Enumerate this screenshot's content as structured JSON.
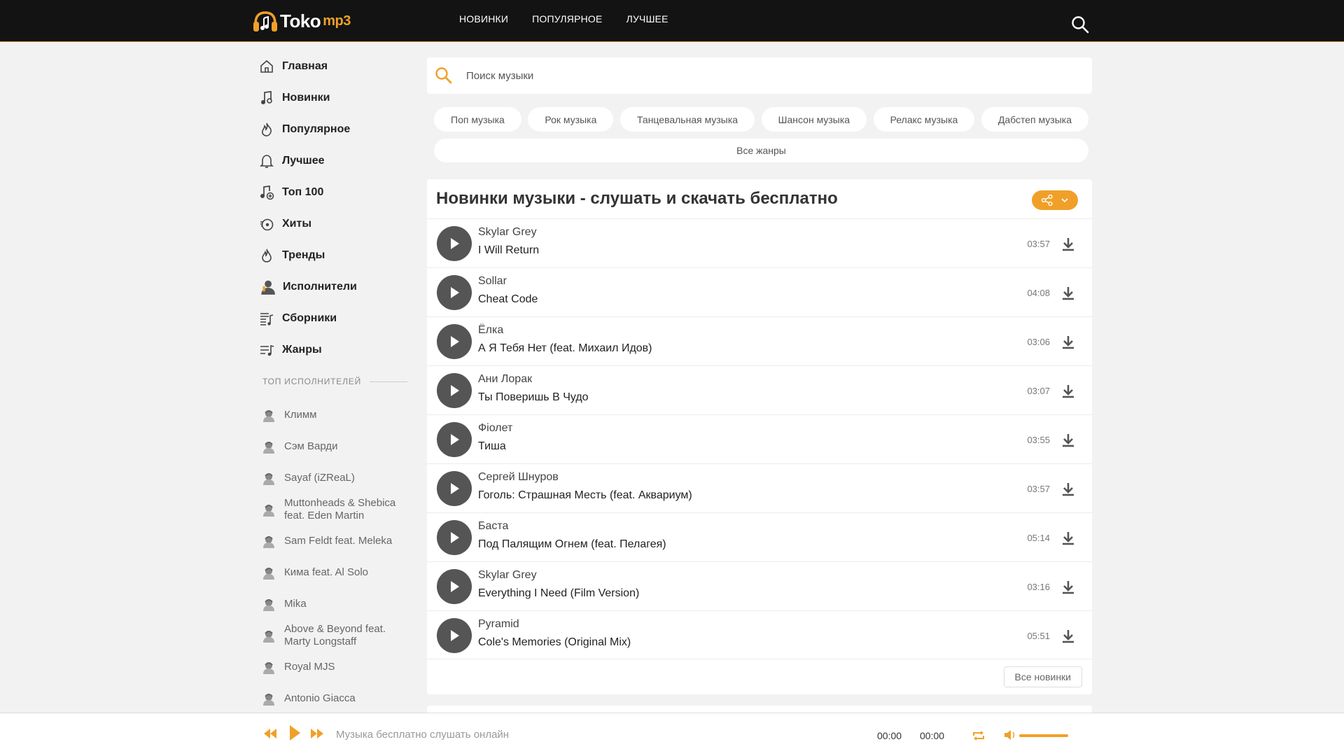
{
  "header": {
    "logo_text": "Toko",
    "logo_suffix": "mp3",
    "nav": [
      "НОВИНКИ",
      "ПОПУЛЯРНОЕ",
      "ЛУЧШЕЕ"
    ]
  },
  "sidebar": {
    "items": [
      {
        "label": "Главная",
        "icon": "home-icon"
      },
      {
        "label": "Новинки",
        "icon": "music-note-icon"
      },
      {
        "label": "Популярное",
        "icon": "flame-icon"
      },
      {
        "label": "Лучшее",
        "icon": "bell-icon"
      },
      {
        "label": "Топ 100",
        "icon": "music-plus-icon"
      },
      {
        "label": "Хиты",
        "icon": "vinyl-icon"
      },
      {
        "label": "Тренды",
        "icon": "drop-flame-icon"
      },
      {
        "label": "Исполнители",
        "icon": "singer-icon"
      },
      {
        "label": "Сборники",
        "icon": "playlist-icon"
      },
      {
        "label": "Жанры",
        "icon": "genres-icon"
      }
    ],
    "top_artists_heading": "ТОП ИСПОЛНИТЕЛЕЙ",
    "top_artists": [
      "Климм",
      "Сэм Варди",
      "Sayaf (iZReaL)",
      "Muttonheads & Shebica feat. Eden Martin",
      "Sam Feldt feat. Meleka",
      "Кима feat. Al Solo",
      "Mika",
      "Above & Beyond feat. Marty Longstaff",
      "Royal MJS",
      "Antonio Giacca"
    ]
  },
  "search": {
    "placeholder": "Поиск музыки"
  },
  "genres": [
    "Поп музыка",
    "Рок музыка",
    "Танцевальная музыка",
    "Шансон музыка",
    "Релакс музыка",
    "Дабстеп музыка"
  ],
  "all_genres_label": "Все жанры ",
  "main": {
    "title": "Новинки музыки - слушать и скачать бесплатно",
    "tracks": [
      {
        "artist": "Skylar Grey",
        "title": "I Will Return",
        "duration": "03:57"
      },
      {
        "artist": "Sollar",
        "title": "Cheat Code",
        "duration": "04:08"
      },
      {
        "artist": "Ёлка",
        "title": "А Я Тебя Нет (feat. Михаил Идов)",
        "duration": "03:06"
      },
      {
        "artist": "Ани Лорак",
        "title": "Ты Поверишь В Чудо",
        "duration": "03:07"
      },
      {
        "artist": "Фіолет",
        "title": "Тиша",
        "duration": "03:55"
      },
      {
        "artist": "Сергей Шнуров",
        "title": "Гоголь: Страшная Месть (feat. Аквариум)",
        "duration": "03:57"
      },
      {
        "artist": "Баста",
        "title": "Под Палящим Огнем (feat. Пелагея)",
        "duration": "05:14"
      },
      {
        "artist": "Skylar Grey",
        "title": "Everything I Need (Film Version)",
        "duration": "03:16"
      },
      {
        "artist": "Pyramid",
        "title": "Cole's Memories (Original Mix)",
        "duration": "05:51"
      }
    ],
    "all_new_label": "Все новинки "
  },
  "player": {
    "title": "Музыка бесплатно слушать онлайн",
    "current_time": "00:00",
    "total_time": "00:00",
    "volume": 1.0
  },
  "colors": {
    "accent": "#f0a028",
    "header_bg": "#131313",
    "play_button": "#555555"
  }
}
